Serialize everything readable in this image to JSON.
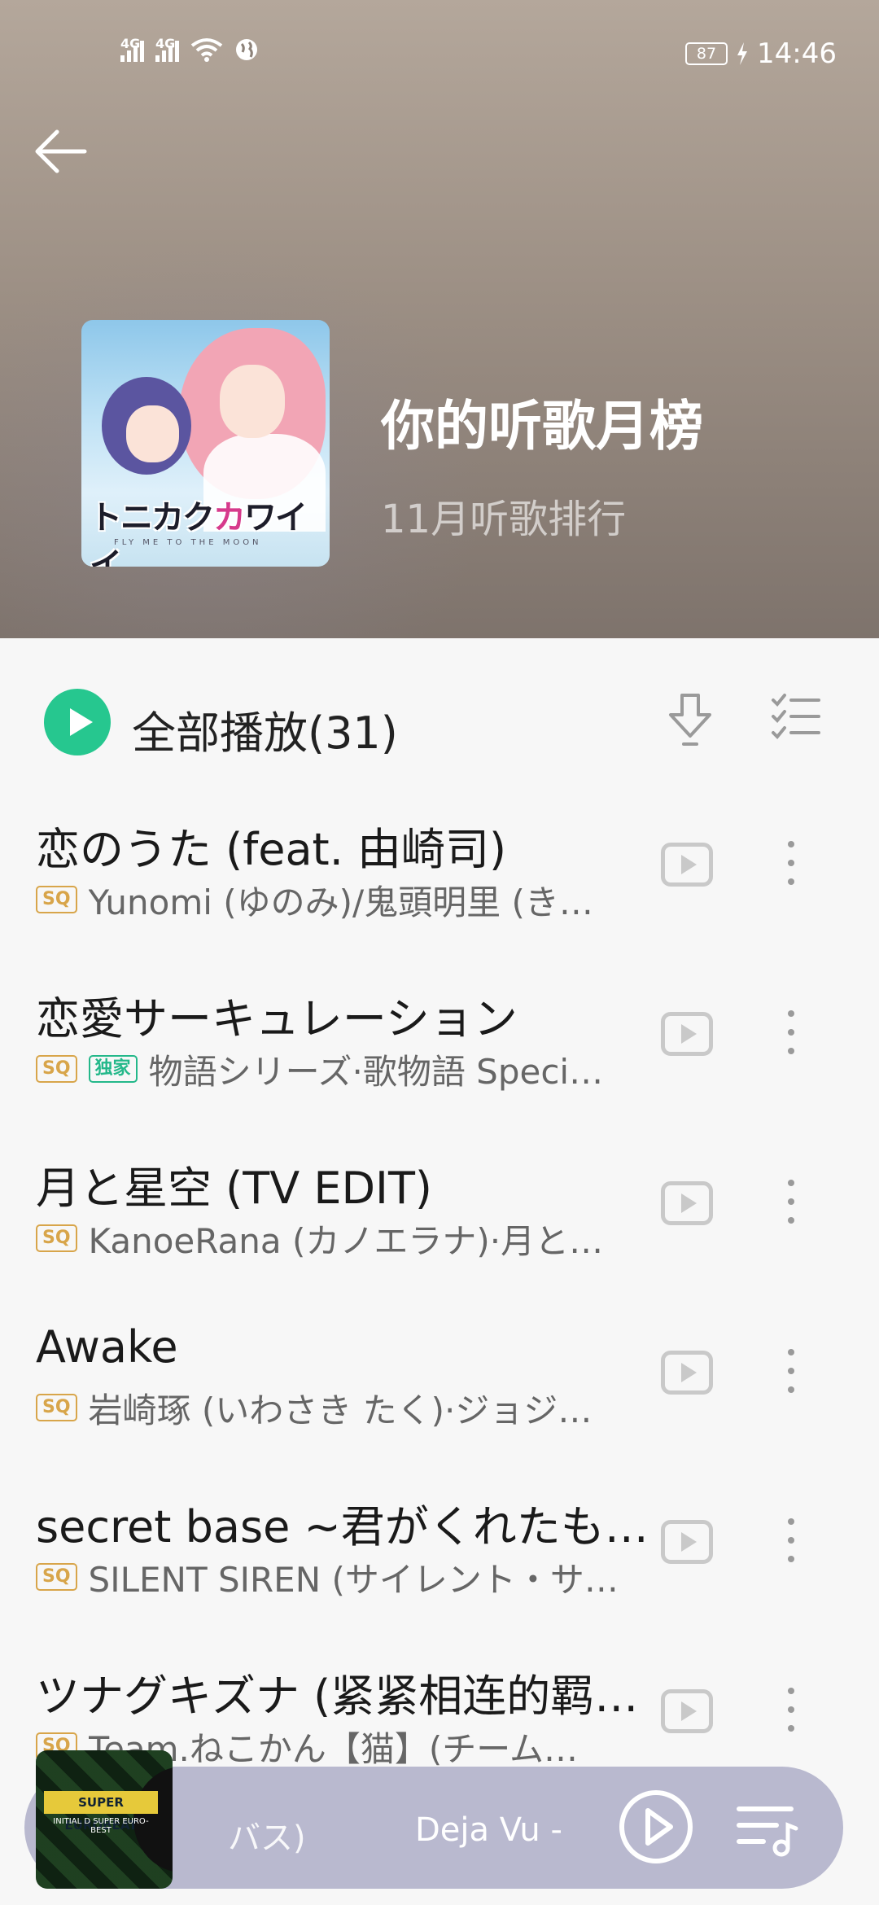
{
  "status_bar": {
    "signal1_label": "4G",
    "signal2_label": "4G",
    "battery": "87",
    "time": "14:46"
  },
  "header": {
    "title": "你的听歌月榜",
    "subtitle": "11月听歌排行",
    "cover_logo_dark": "トニカク",
    "cover_logo_pink": "カ",
    "cover_logo_dark2": "ワイイ",
    "cover_caption": "FLY ME TO THE MOON"
  },
  "list": {
    "play_all_label": "全部播放(31)",
    "songs": [
      {
        "title": "恋のうた (feat. 由崎司)",
        "badges": [
          "SQ"
        ],
        "artist": "Yunomi (ゆのみ)/鬼頭明里 (き…"
      },
      {
        "title": "恋愛サーキュレーション",
        "badges": [
          "SQ",
          "独家"
        ],
        "artist": "物語シリーズ·歌物語 Speci…"
      },
      {
        "title": "月と星空 (TV EDIT)",
        "badges": [
          "SQ"
        ],
        "artist": "KanoeRana (カノエラナ)·月と…"
      },
      {
        "title": "Awake",
        "badges": [
          "SQ"
        ],
        "artist": "岩崎琢 (いわさき たく)·ジョジ…"
      },
      {
        "title": "secret base ~君がくれたも…",
        "badges": [
          "SQ"
        ],
        "artist": "SILENT SIREN (サイレント・サ…"
      },
      {
        "title": "ツナグキズナ (紧紧相连的羁绊)",
        "badges": [
          "SQ"
        ],
        "artist": "Team.ねこかん【猫】(チーム…"
      }
    ]
  },
  "player": {
    "ticker_prev": "バス)",
    "ticker_next": "Deja Vu -",
    "art_line1": "SUPER EUROBEAT",
    "art_line2": "INITIAL D SUPER EURO-BEST"
  },
  "colors": {
    "accent": "#26c78f",
    "sq_badge": "#d8a54a",
    "exclusive_badge": "#24b88a",
    "player_bar": "#b9b9cf"
  },
  "icons": {
    "back": "arrow-left-icon",
    "download": "download-icon",
    "multi_select": "checklist-icon",
    "mv": "video-play-icon",
    "more": "more-vertical-icon",
    "play_pause": "play-circle-icon",
    "queue": "playlist-icon"
  }
}
